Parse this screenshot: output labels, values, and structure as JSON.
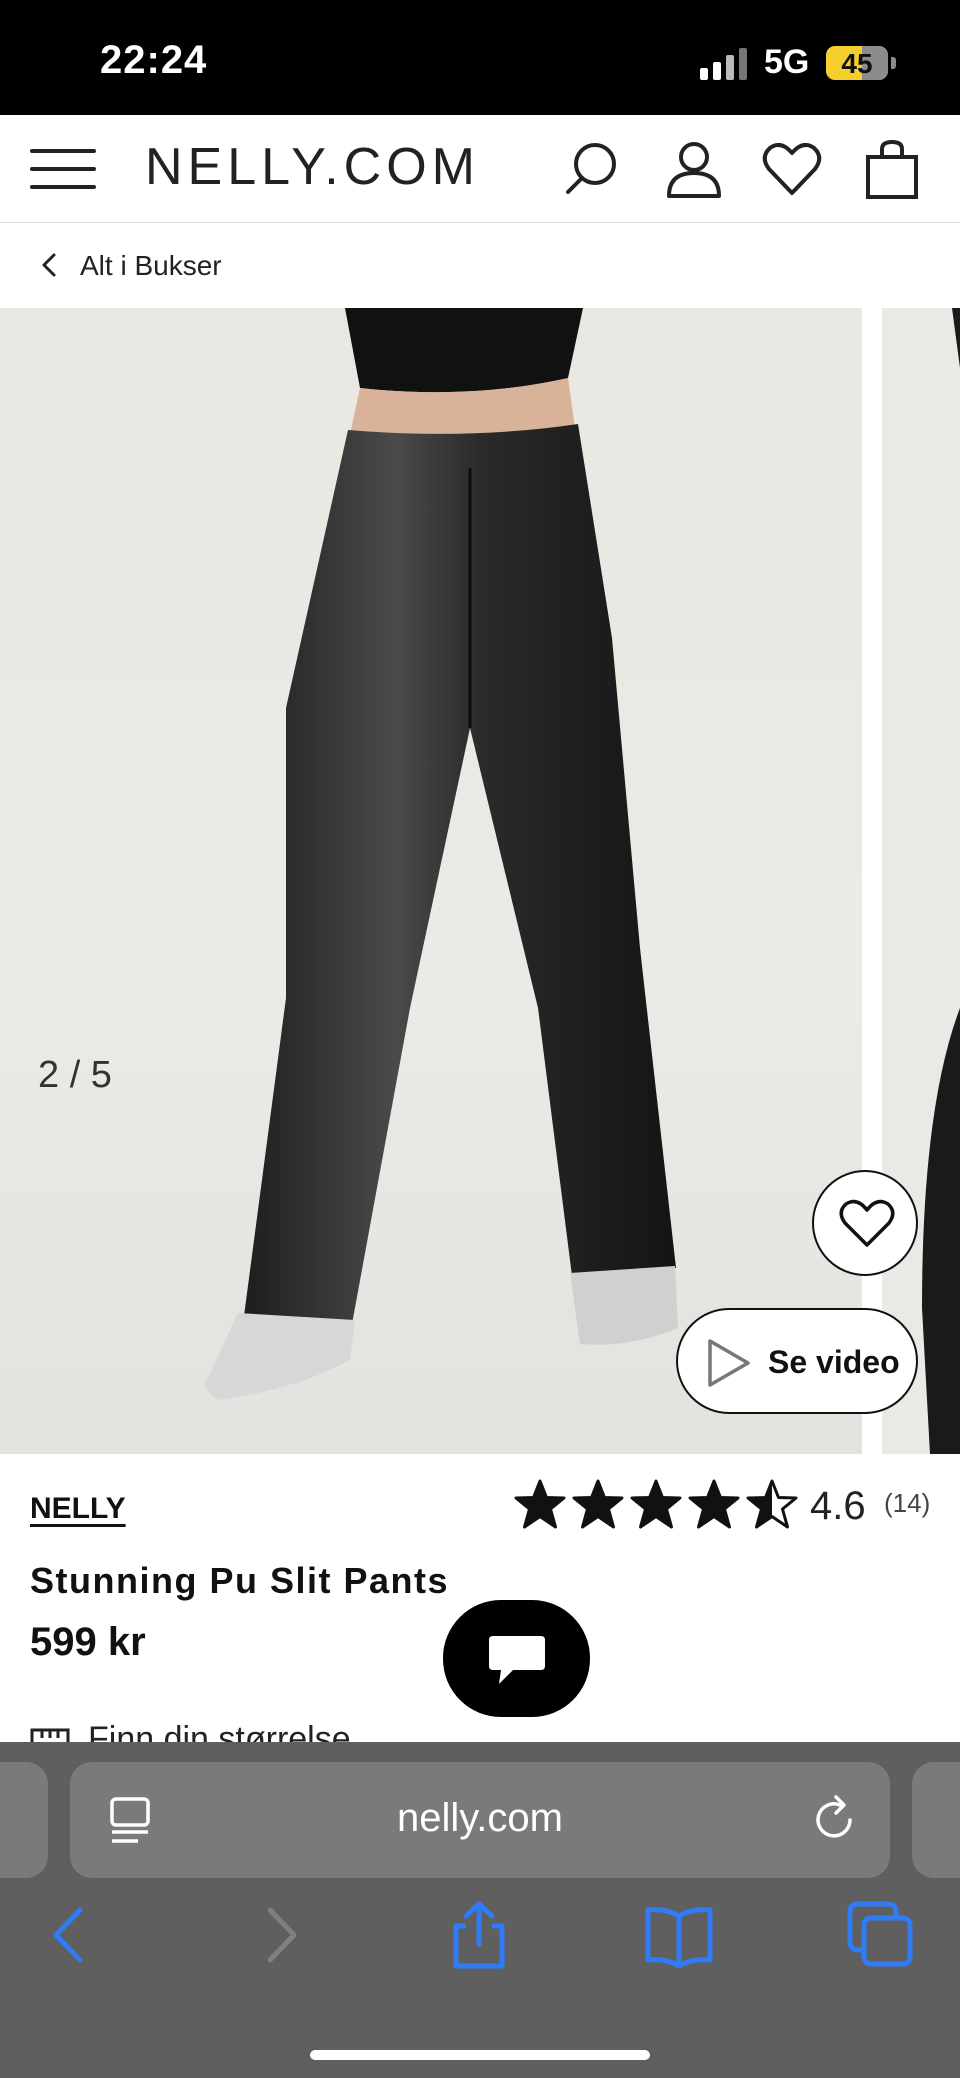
{
  "status_bar": {
    "time": "22:24",
    "network": "5G",
    "battery": "45"
  },
  "header": {
    "logo": "NELLY.COM"
  },
  "breadcrumb": {
    "label": "Alt i Bukser"
  },
  "gallery": {
    "counter": "2 / 5",
    "video_label": "Se video"
  },
  "product": {
    "brand": "NELLY",
    "rating": "4.6",
    "rating_stars": 4.5,
    "review_count": "(14)",
    "name": "Stunning Pu Slit Pants",
    "price": "599 kr",
    "size_guide": "Finn din størrelse"
  },
  "browser": {
    "url": "nelly.com"
  },
  "colors": {
    "accent": "#2f7cf6",
    "header_bg": "#000000",
    "toolbar_bg": "#5f5f5f"
  }
}
